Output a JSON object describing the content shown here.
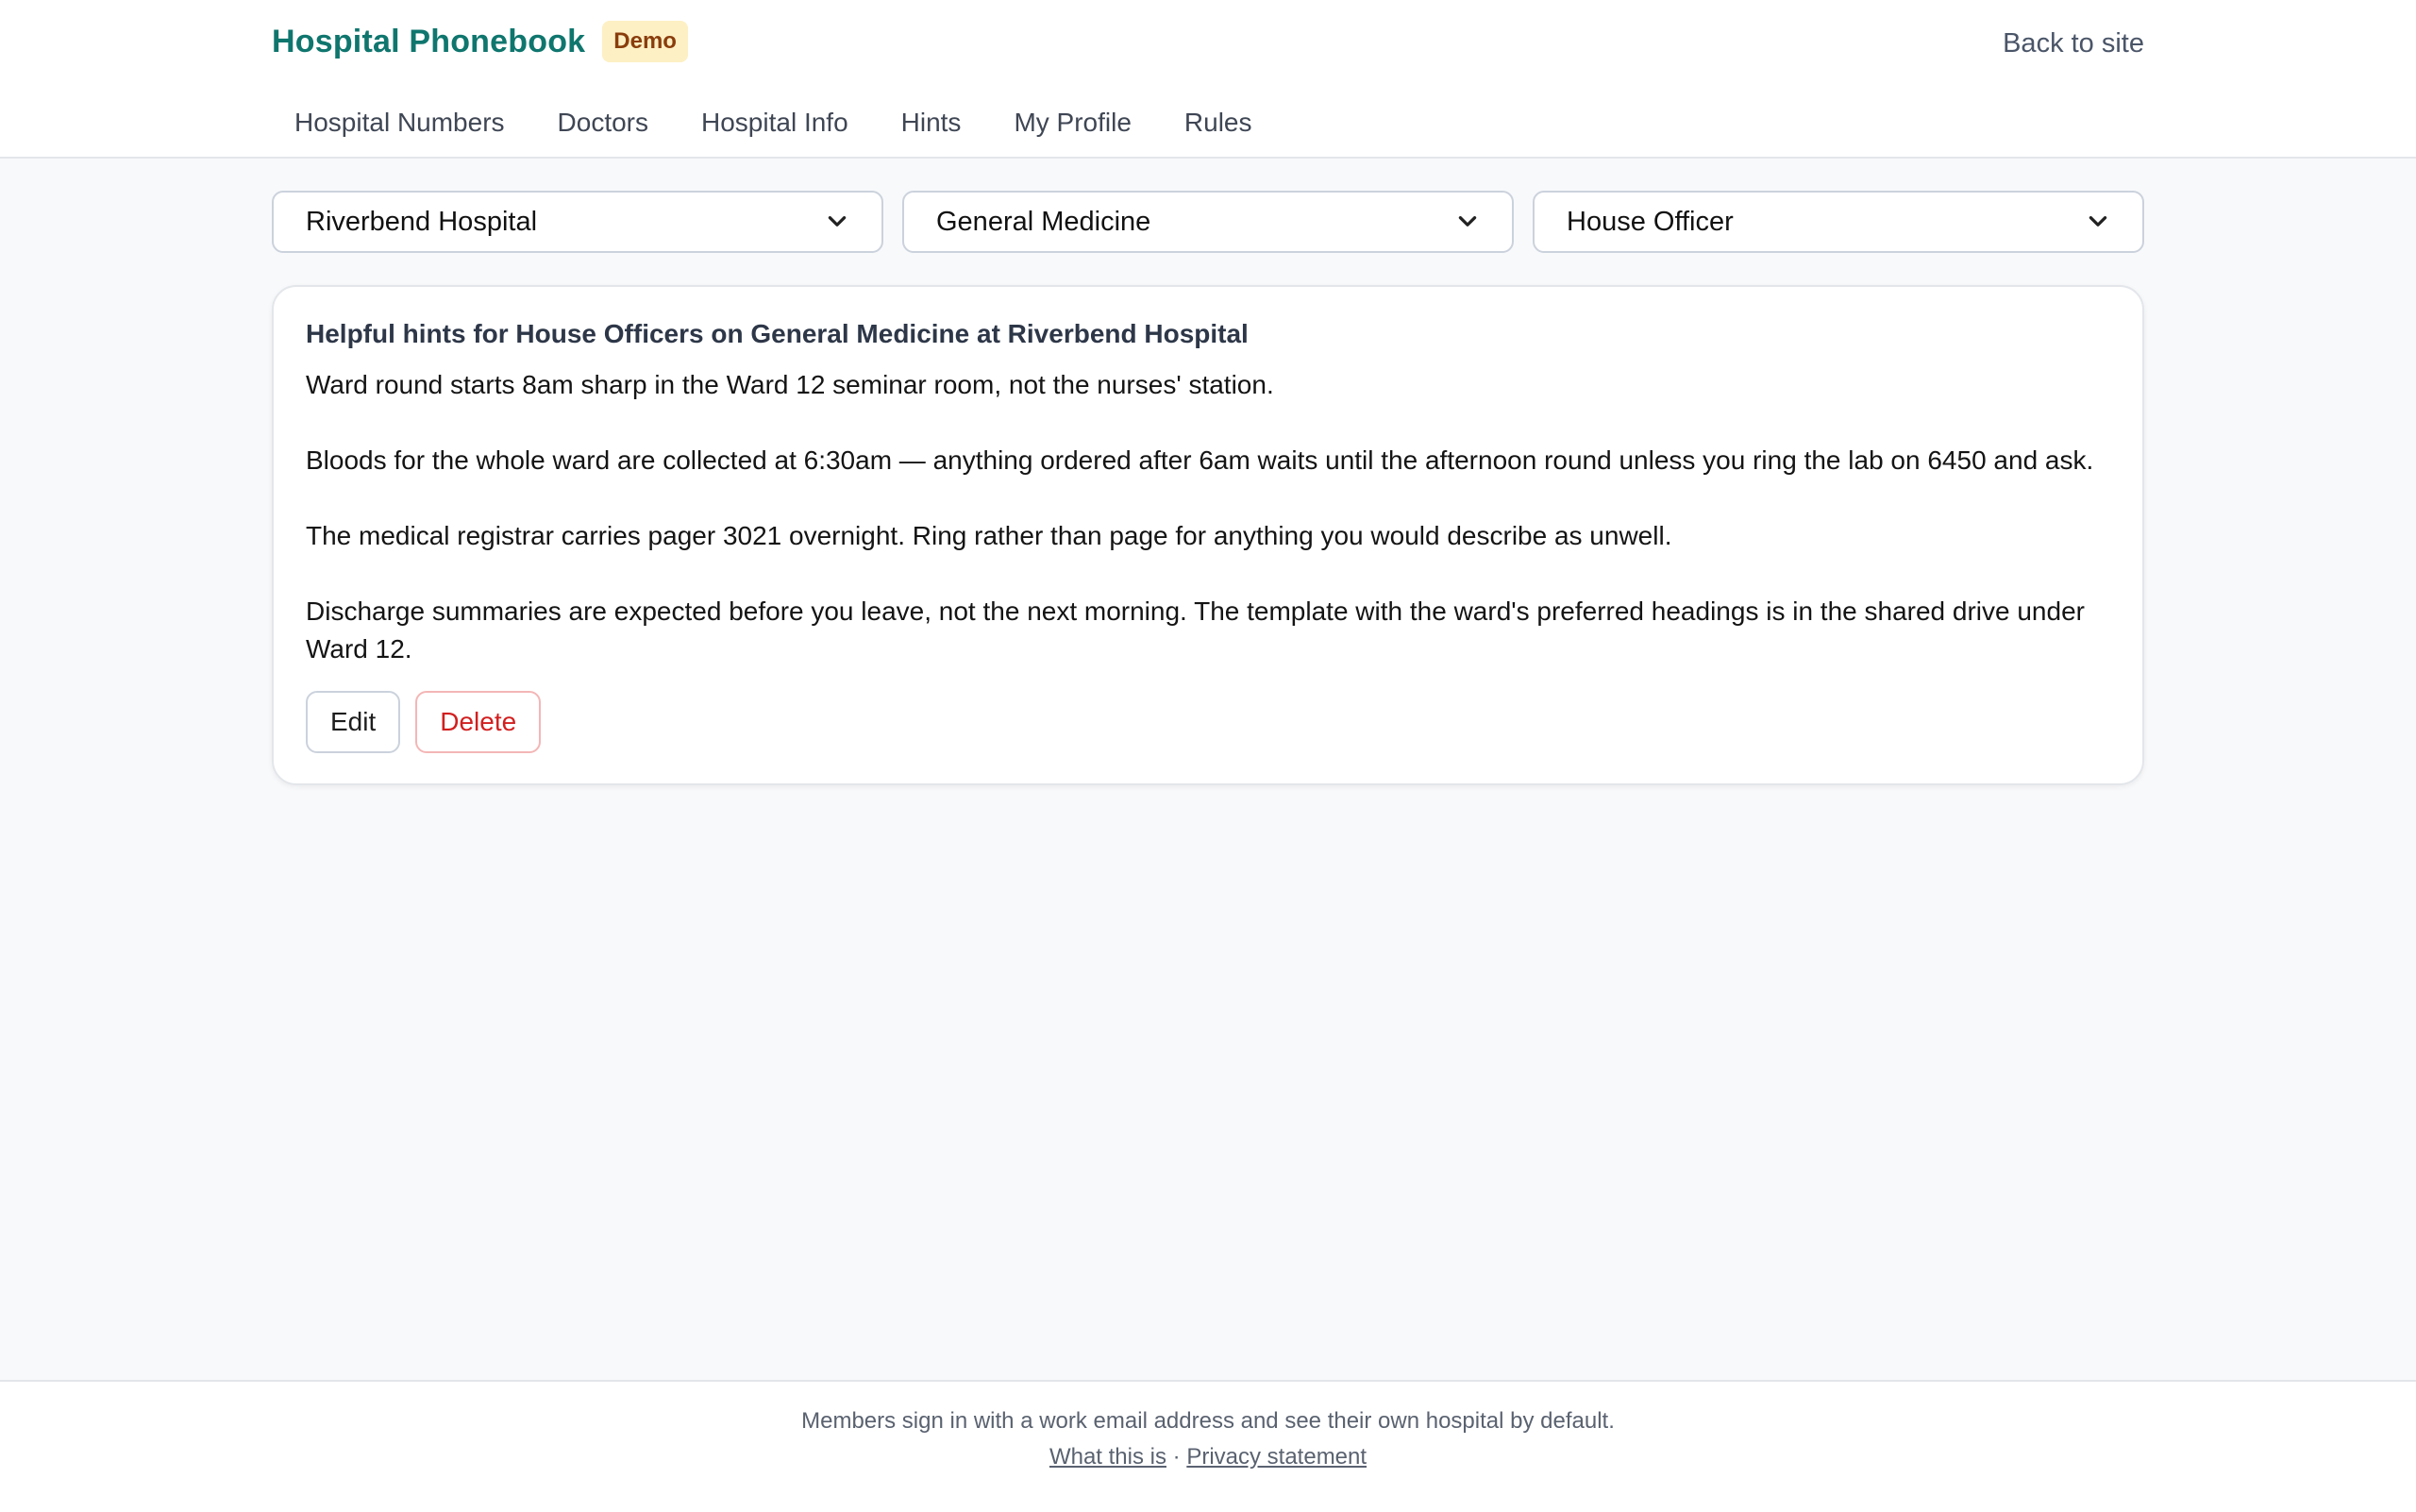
{
  "header": {
    "brand_title": "Hospital Phonebook",
    "badge": "Demo",
    "back_link": "Back to site"
  },
  "nav": {
    "items": [
      {
        "label": "Hospital Numbers"
      },
      {
        "label": "Doctors"
      },
      {
        "label": "Hospital Info"
      },
      {
        "label": "Hints"
      },
      {
        "label": "My Profile"
      },
      {
        "label": "Rules"
      }
    ]
  },
  "filters": {
    "hospital": "Riverbend Hospital",
    "specialty": "General Medicine",
    "role": "House Officer"
  },
  "card": {
    "title": "Helpful hints for House Officers on General Medicine at Riverbend Hospital",
    "hints": [
      "Ward round starts 8am sharp in the Ward 12 seminar room, not the nurses' station.",
      "Bloods for the whole ward are collected at 6:30am — anything ordered after 6am waits until the afternoon round unless you ring the lab on 6450 and ask.",
      "The medical registrar carries pager 3021 overnight. Ring rather than page for anything you would describe as unwell.",
      "Discharge summaries are expected before you leave, not the next morning. The template with the ward's preferred headings is in the shared drive under Ward 12."
    ],
    "edit_label": "Edit",
    "delete_label": "Delete"
  },
  "footer": {
    "text": "Members sign in with a work email address and see their own hospital by default.",
    "link_what": "What this is",
    "separator": "·",
    "link_privacy": "Privacy statement"
  },
  "icons": {
    "select_chevron": "chevron-down-icon"
  }
}
